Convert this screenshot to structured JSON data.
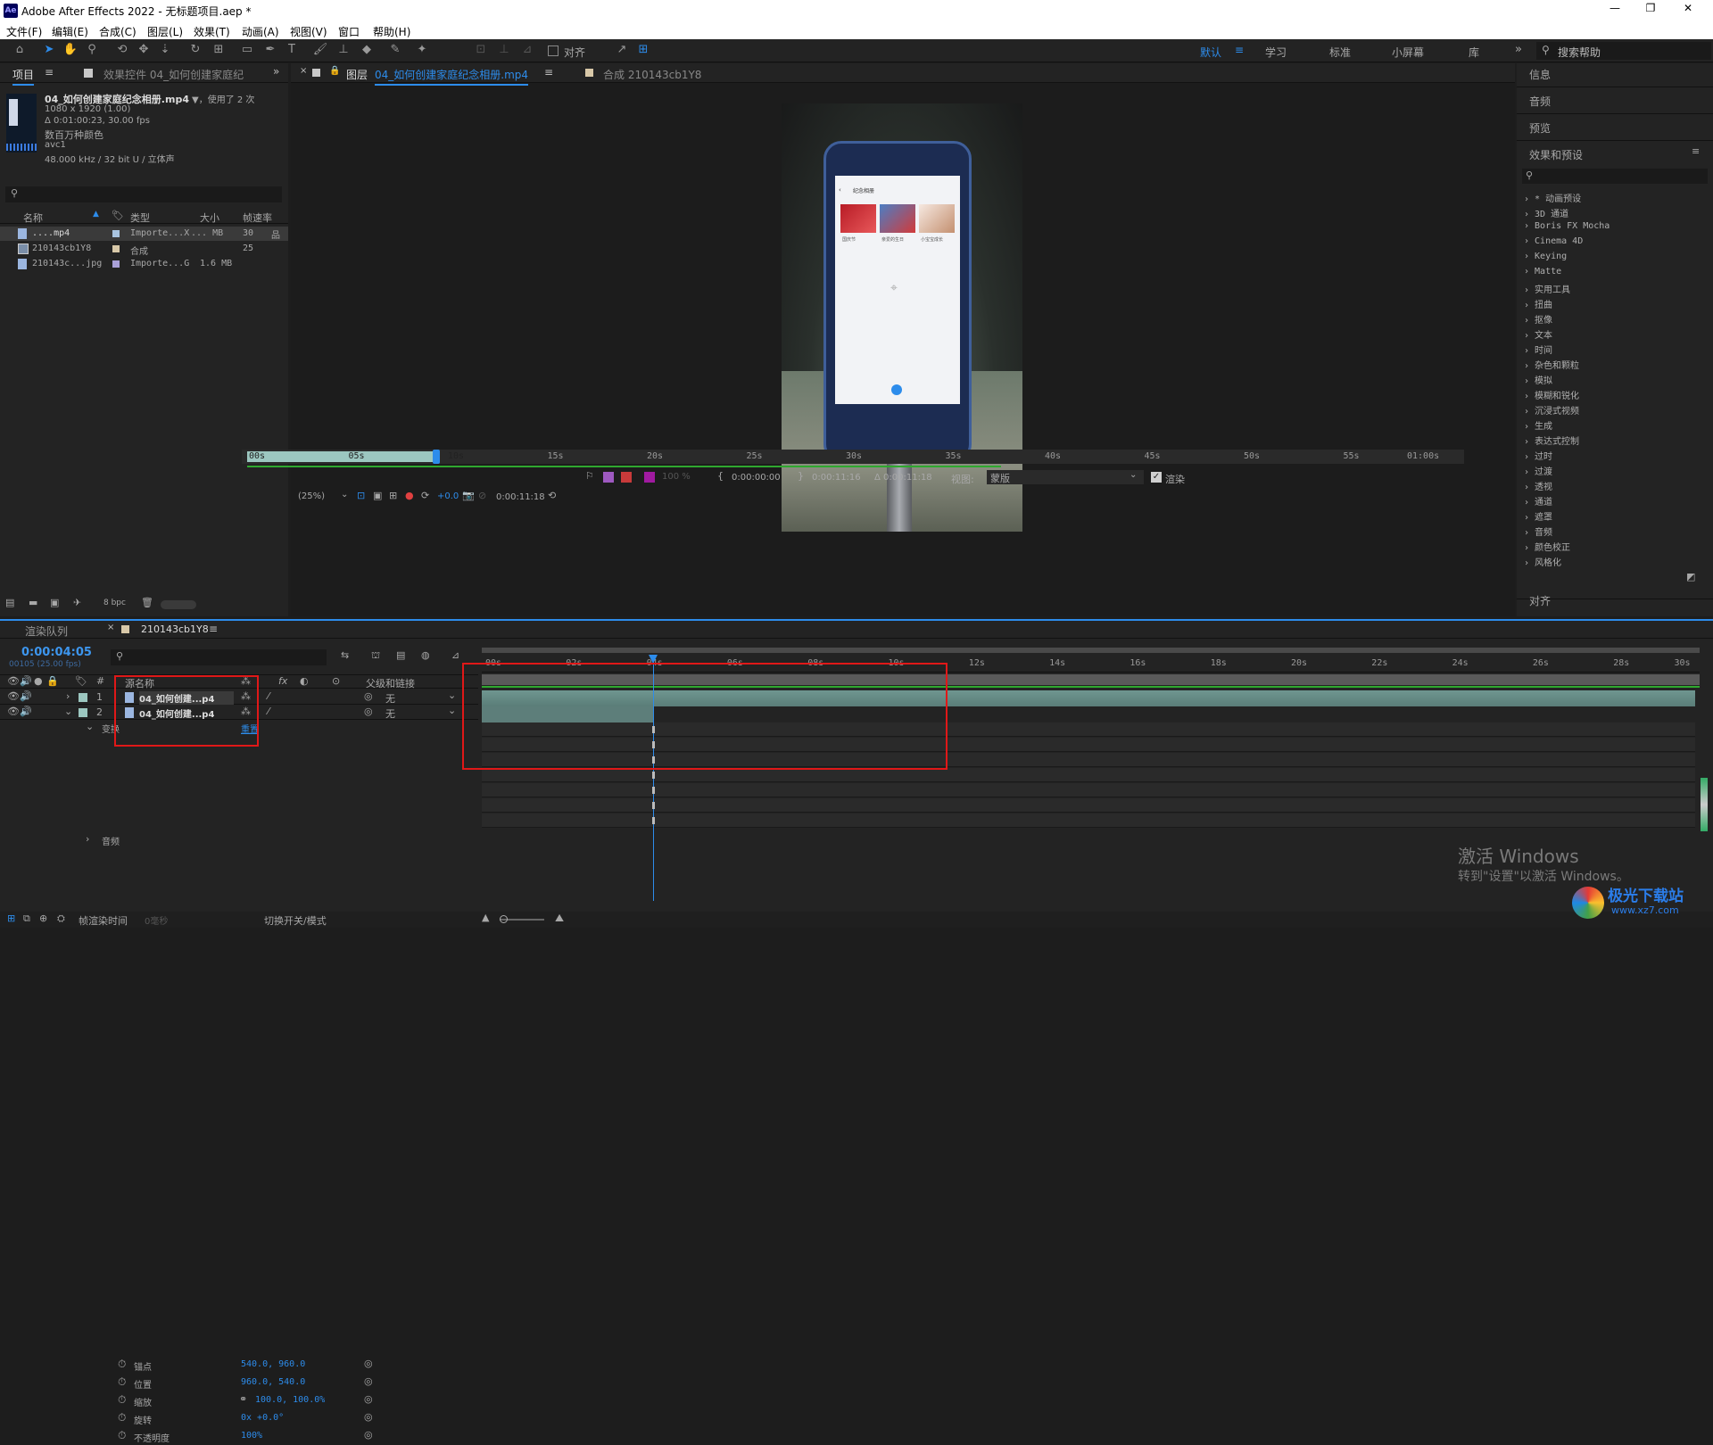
{
  "window": {
    "title": "Adobe After Effects 2022 - 无标题项目.aep *",
    "app_icon": "Ae",
    "controls": [
      "—",
      "❐",
      "✕"
    ]
  },
  "menu": [
    "文件(F)",
    "编辑(E)",
    "合成(C)",
    "图层(L)",
    "效果(T)",
    "动画(A)",
    "视图(V)",
    "窗口",
    "帮助(H)"
  ],
  "toolbar": {
    "align_label": "对齐",
    "workspaces": [
      "默认",
      "学习",
      "标准",
      "小屏幕",
      "库"
    ],
    "search_placeholder": "搜索帮助"
  },
  "project_panel": {
    "tabs": [
      "项目",
      "效果控件 04_如何创建家庭纪"
    ],
    "file_name": "04_如何创建家庭纪念相册.mp4",
    "used_count": "▼，使用了 2 次",
    "info_lines": [
      "1080 x 1920 (1.00)",
      "Δ 0:01:00:23, 30.00 fps",
      "数百万种颜色",
      "avc1",
      "48.000 kHz / 32 bit U / 立体声"
    ],
    "columns": [
      "名称",
      "类型",
      "大小",
      "帧速率"
    ],
    "items": [
      {
        "name": "....mp4",
        "type": "Importe...X",
        "size": "... MB",
        "fps": "30"
      },
      {
        "name": "210143cb1Y8",
        "type": "合成",
        "size": "",
        "fps": "25"
      },
      {
        "name": "210143c...jpg",
        "type": "Importe...G",
        "size": "1.6 MB",
        "fps": ""
      }
    ],
    "bpc": "8 bpc"
  },
  "viewer": {
    "tab_layer_prefix": "图层",
    "tab_layer_name": "04_如何创建家庭纪念相册.mp4",
    "tab_comp": "合成 210143cb1Y8",
    "ruler_labels": [
      "00s",
      "05s",
      "10s",
      "15s",
      "20s",
      "25s",
      "30s",
      "35s",
      "40s",
      "45s",
      "50s",
      "55s",
      "01:00s"
    ],
    "zoom": "(25%)",
    "exposure": "+0.0",
    "current_time": "0:00:11:18",
    "in_time": "0:00:00:00",
    "out_time": "0:00:11:16",
    "duration": "Δ 0:00:11:18",
    "view_label": "视图:",
    "view_value": "蒙版",
    "render_label": "渲染",
    "opacity_label": "100 %",
    "phone_header": "纪念相册",
    "phone_captions": [
      "国庆节",
      "亲爱的生日",
      "小宝宝成长"
    ]
  },
  "right_panel": {
    "sections": [
      "信息",
      "音频",
      "预览",
      "效果和预设"
    ],
    "effects": [
      "* 动画预设",
      "3D 通道",
      "Boris FX Mocha",
      "Cinema 4D",
      "Keying",
      "Matte",
      "实用工具",
      "扭曲",
      "抠像",
      "文本",
      "时间",
      "杂色和颗粒",
      "模拟",
      "模糊和锐化",
      "沉浸式视频",
      "生成",
      "表达式控制",
      "过时",
      "过渡",
      "透视",
      "通道",
      "遮罩",
      "音频",
      "颜色校正",
      "风格化"
    ],
    "align": "对齐"
  },
  "timeline": {
    "tabs": [
      "渲染队列",
      "210143cb1Y8"
    ],
    "timecode": "0:00:04:05",
    "frame_info": "00105 (25.00 fps)",
    "columns": {
      "source": "源名称",
      "parent": "父级和链接"
    },
    "layers": [
      {
        "num": "1",
        "name": "04_如何创建...p4",
        "parent": "无"
      },
      {
        "num": "2",
        "name": "04_如何创建...p4",
        "parent": "无"
      }
    ],
    "transform_label": "变换",
    "reset_label": "重置",
    "properties": [
      {
        "name": "锚点",
        "value": "540.0, 960.0"
      },
      {
        "name": "位置",
        "value": "960.0, 540.0"
      },
      {
        "name": "缩放",
        "value": "100.0, 100.0%"
      },
      {
        "name": "旋转",
        "value": "0x +0.0°"
      },
      {
        "name": "不透明度",
        "value": "100%"
      }
    ],
    "audio_label": "音频",
    "ruler_labels": [
      "00s",
      "02s",
      "04s",
      "06s",
      "08s",
      "10s",
      "12s",
      "14s",
      "16s",
      "18s",
      "20s",
      "22s",
      "24s",
      "26s",
      "28s",
      "30s"
    ],
    "footer_render": "帧渲染时间",
    "footer_ms": "0毫秒",
    "footer_toggle": "切换开关/模式"
  },
  "watermark": {
    "line1": "激活 Windows",
    "line2": "转到\"设置\"以激活 Windows。"
  },
  "site_logo": {
    "text": "极光下载站",
    "url_text": "www.xz7.com"
  }
}
